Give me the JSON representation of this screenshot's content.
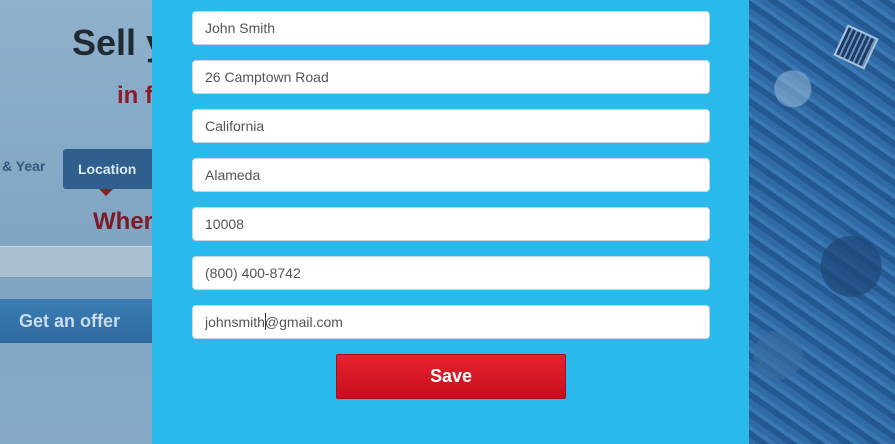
{
  "background": {
    "title": "Sell y",
    "subtitle": "in f",
    "steps": {
      "make_year": "& Year",
      "location": "Location"
    },
    "where": "Wher",
    "offer_button": "Get an offer"
  },
  "form": {
    "fields": [
      {
        "name": "name-field",
        "value": "John Smith"
      },
      {
        "name": "address-field",
        "value": "26 Camptown Road"
      },
      {
        "name": "state-field",
        "value": "California"
      },
      {
        "name": "city-field",
        "value": "Alameda"
      },
      {
        "name": "zip-field",
        "value": "10008"
      },
      {
        "name": "phone-field",
        "value": "(800) 400-8742"
      },
      {
        "name": "email-field",
        "value": "johnsmith@gmail.com"
      }
    ],
    "save_label": "Save"
  },
  "colors": {
    "modal_bg": "#29b9ea",
    "save_button": "#e01c2a",
    "location_tab": "#2f5f8c",
    "offer_button": "#3477ad"
  }
}
